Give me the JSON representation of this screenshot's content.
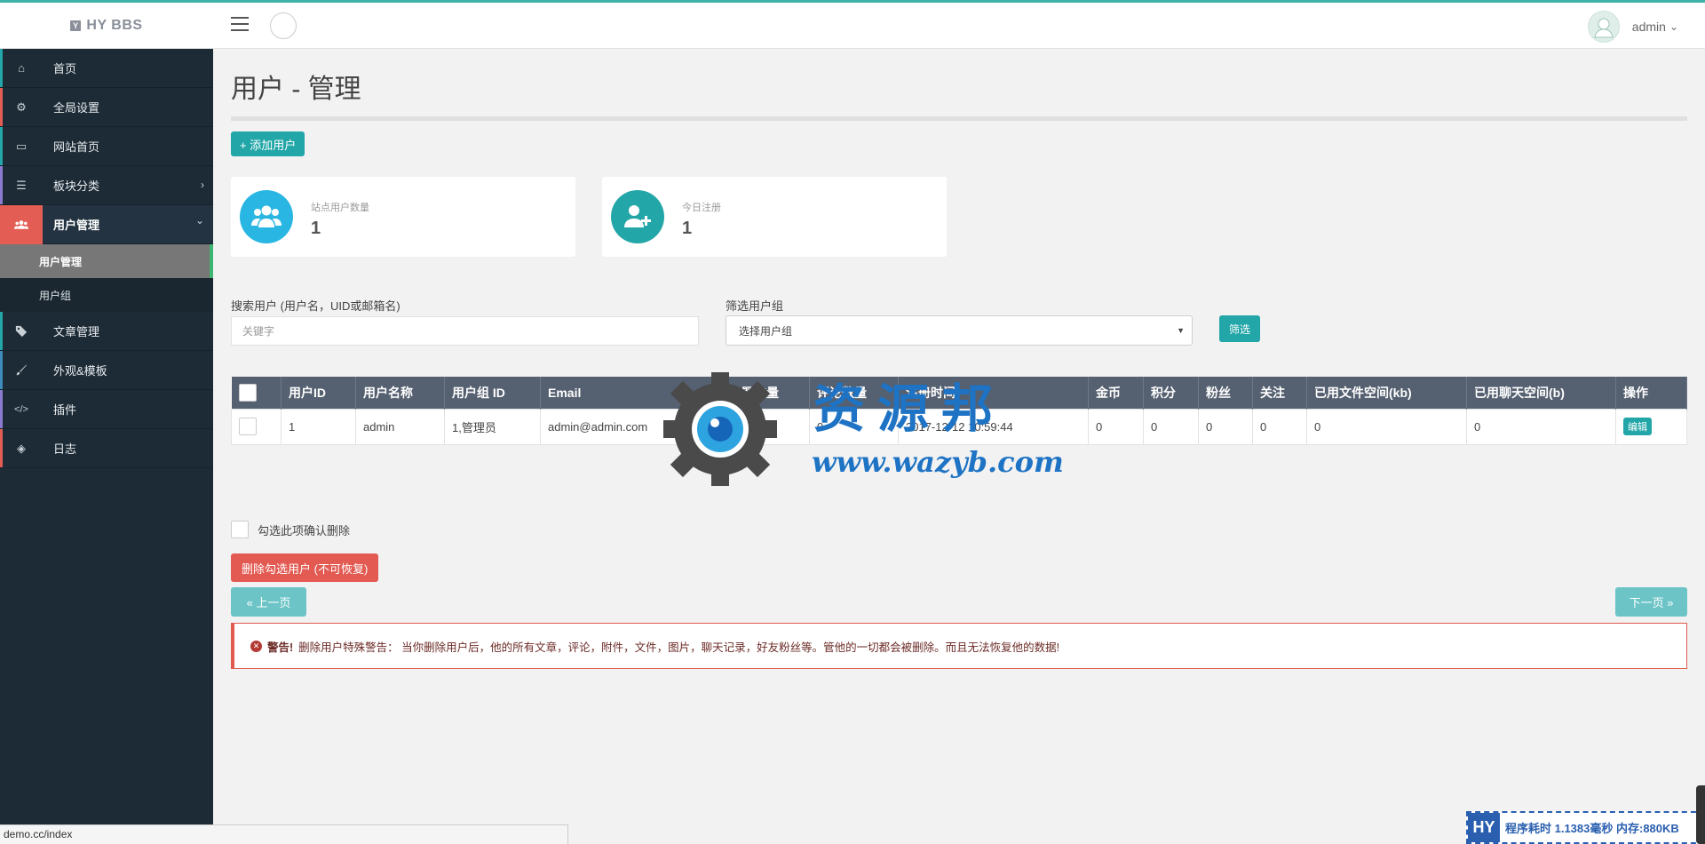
{
  "brand": {
    "logo_letter": "Y",
    "name": "HY BBS"
  },
  "user": {
    "name": "admin",
    "caret": "⌄"
  },
  "sidebar": {
    "items": [
      {
        "label": "首页",
        "icon": "home-icon",
        "glyph": "⌂",
        "stripe": "#23a6a8"
      },
      {
        "label": "全局设置",
        "icon": "gear-icon",
        "glyph": "⚙",
        "stripe": "#e45d55"
      },
      {
        "label": "网站首页",
        "icon": "monitor-icon",
        "glyph": "▭",
        "stripe": "#23a6a8"
      },
      {
        "label": "板块分类",
        "icon": "list-icon",
        "glyph": "☰",
        "stripe": "#8a7bd1",
        "arrow": "›"
      },
      {
        "label": "用户管理",
        "icon": "users-icon",
        "glyph": "👥",
        "stripe": "#e45d55",
        "arrow": "⌄"
      },
      {
        "label": "文章管理",
        "icon": "tags-icon",
        "glyph": "🏷",
        "stripe": "#23a6a8"
      },
      {
        "label": "外观&模板",
        "icon": "brush-icon",
        "glyph": "✎",
        "stripe": "#3c8dbc"
      },
      {
        "label": "插件",
        "icon": "code-icon",
        "glyph": "</>",
        "stripe": "#8a7bd1"
      },
      {
        "label": "日志",
        "icon": "cube-icon",
        "glyph": "◈",
        "stripe": "#e45d55"
      }
    ],
    "subitems": [
      {
        "label": "用户管理"
      },
      {
        "label": "用户组"
      }
    ]
  },
  "page": {
    "title": "用户 - 管理"
  },
  "actions": {
    "add_user": "+ 添加用户"
  },
  "stats": {
    "total_label": "站点用户数量",
    "total_value": "1",
    "today_label": "今日注册",
    "today_value": "1",
    "total_color": "#29b6e3",
    "today_color": "#23a6a8"
  },
  "filters": {
    "search_label": "搜索用户 (用户名，UID或邮箱名)",
    "search_placeholder": "关键字",
    "group_label": "筛选用户组",
    "group_value": "选择用户组",
    "filter_button": "筛选"
  },
  "table": {
    "headers": [
      "用户ID",
      "用户名称",
      "用户组 ID",
      "Email",
      "主题数量",
      "评论数量",
      "注册时间",
      "金币",
      "积分",
      "粉丝",
      "关注",
      "已用文件空间(kb)",
      "已用聊天空间(b)",
      "操作"
    ],
    "rows": [
      {
        "id": "1",
        "name": "admin",
        "group": "1,管理员",
        "email": "admin@admin.com",
        "threads": "0",
        "comments": "0",
        "registered": "2017-12-12 10:59:44",
        "gold": "0",
        "points": "0",
        "fans": "0",
        "follow": "0",
        "file_space": "0",
        "chat_space": "0",
        "edit": "编辑"
      }
    ]
  },
  "delete": {
    "confirm_label": "勾选此项确认删除",
    "button": "删除勾选用户 (不可恢复)"
  },
  "pagination": {
    "prev": "« 上一页",
    "next": "下一页 »"
  },
  "alert": {
    "strong": "警告!",
    "text": "删除用户特殊警告： 当你删除用户后，他的所有文章，评论，附件，文件，图片，聊天记录，好友粉丝等。管他的一切都会被删除。而且无法恢复他的数据!"
  },
  "watermark": {
    "cn": "资源邦",
    "url": "www.wazyb.com"
  },
  "statusbar": {
    "url": "demo.cc/index"
  },
  "perf": {
    "logo": "HY",
    "text": "程序耗时 1.1383毫秒 内存:880KB"
  }
}
